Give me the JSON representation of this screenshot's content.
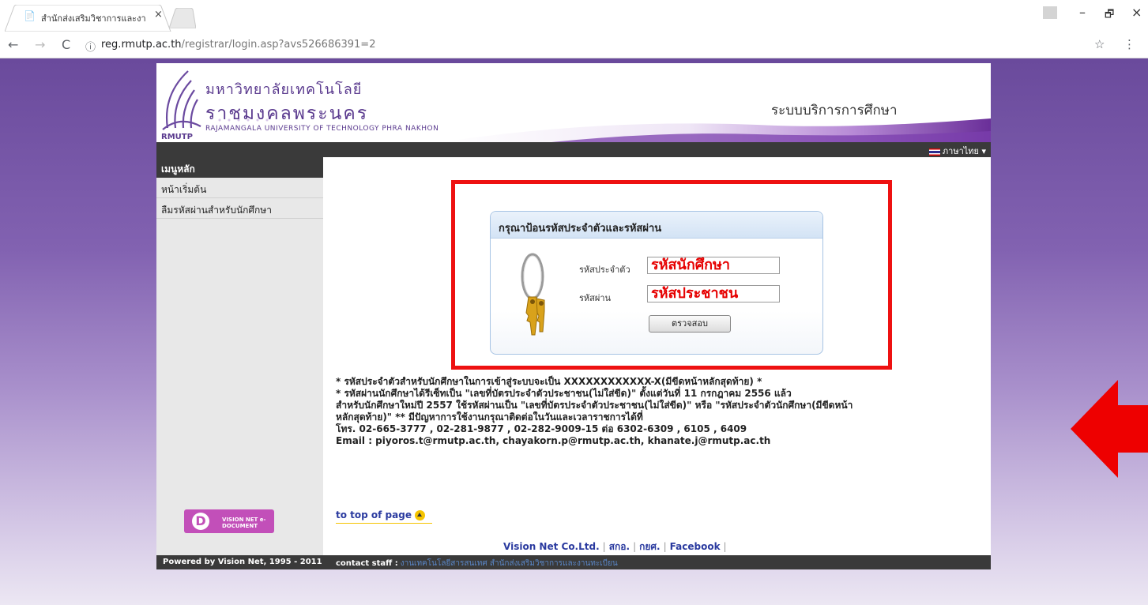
{
  "browser": {
    "tab_title": "สำนักส่งเสริมวิชาการและงาน",
    "tab_close": "×",
    "back": "←",
    "forward": "→",
    "reload": "C",
    "info": "ⓘ",
    "url_host": "reg.rmutp.ac.th",
    "url_path": "/registrar/login.asp?avs526686391=2",
    "bookmark": "☆",
    "menu": "⋮",
    "minimize": "–",
    "restore": "🗗",
    "close": "×"
  },
  "header": {
    "university_th_line1": "มหาวิทยาลัยเทคโนโลยี",
    "university_th_line2": "ราชมงคลพระนคร",
    "university_en": "RAJAMANGALA UNIVERSITY  OF TECHNOLOGY PHRA NAKHON",
    "logo_abbr": "RMUTP",
    "system_title": "ระบบบริการการศึกษา",
    "language": "ภาษาไทย ▾"
  },
  "sidebar": {
    "heading": "เมนูหลัก",
    "items": [
      {
        "label": "หน้าเริ่มต้น"
      },
      {
        "label": "ลืมรหัสผ่านสำหรับนักศึกษา"
      }
    ],
    "vision_logo_letter": "D",
    "vision_logo_text": "VISION NET e-DOCUMENT"
  },
  "login": {
    "title": "กรุณาป้อนรหัสประจำตัวและรหัสผ่าน",
    "id_label": "รหัสประจำตัว",
    "id_value": "รหัสนักศึกษา",
    "password_label": "รหัสผ่าน",
    "password_value": "รหัสประชาชน",
    "submit_label": "ตรวจสอบ"
  },
  "notes": [
    "* รหัสประจำตัวสำหรับนักศึกษาในการเข้าสู่ระบบจะเป็น XXXXXXXXXXXX-X(มีขีดหน้าหลักสุดท้าย) *",
    "* รหัสผ่านนักศึกษาได้รีเซ็ทเป็น \"เลขที่บัตรประจำตัวประชาชน(ไม่ใส่ขีด)\" ตั้งแต่วันที่ 11 กรกฎาคม 2556 แล้ว",
    "สำหรับนักศึกษาใหม่ปี 2557 ใช้รหัสผ่านเป็น \"เลขที่บัตรประจำตัวประชาชน(ไม่ใส่ขีด)\" หรือ \"รหัสประจำตัวนักศึกษา(มีขีดหน้า",
    "หลักสุดท้าย)\" ** มีปัญหาการใช้งานกรุณาติดต่อในวันและเวลาราชการได้ที่",
    "โทร. 02-665-3777 , 02-281-9877 , 02-282-9009-15 ต่อ 6302-6309 , 6105 , 6409",
    "Email : piyoros.t@rmutp.ac.th, chayakorn.p@rmutp.ac.th, khanate.j@rmutp.ac.th"
  ],
  "to_top": "to top of page",
  "footer_links": [
    "Vision Net Co.Ltd.",
    "สกอ.",
    "กยศ.",
    "Facebook"
  ],
  "footer_sep": "|",
  "bottom": {
    "powered": "Powered by Vision Net, 1995 - 2011",
    "contact_label": "contact staff :",
    "contact_link": "งานเทคโนโลยีสารสนเทศ สำนักส่งเสริมวิชาการและงานทะเบียน"
  },
  "colors": {
    "highlight_border": "#ee1111",
    "arrow": "#ee0000",
    "page_gradient_top": "#6a4a9c",
    "brand_purple": "#5b3b8f"
  }
}
